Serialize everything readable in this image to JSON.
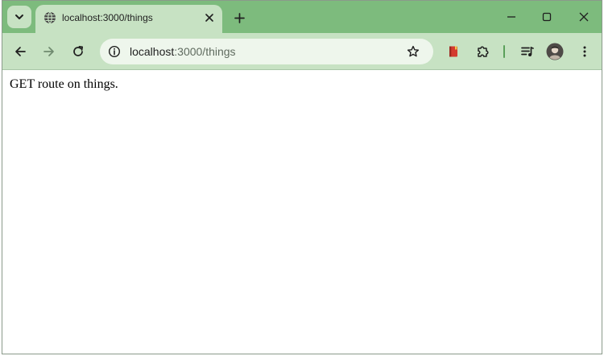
{
  "browser": {
    "tab": {
      "title": "localhost:3000/things",
      "favicon": "globe-icon"
    },
    "address_bar": {
      "host": "localhost",
      "path": ":3000/things"
    },
    "icons": {
      "tab_search": "chevron-down-icon",
      "close_tab": "close-icon",
      "new_tab": "plus-icon",
      "minimize": "minimize-icon",
      "maximize": "maximize-icon",
      "close_window": "close-icon",
      "back": "back-arrow-icon",
      "forward": "forward-arrow-icon",
      "reload": "reload-icon",
      "site_info": "info-icon",
      "bookmark": "star-icon",
      "extension_book": "book-icon",
      "extensions": "puzzle-icon",
      "media": "playlist-icon",
      "profile": "avatar",
      "menu": "more-vertical-icon"
    },
    "colors": {
      "frame": "#7dbb7d",
      "toolbar": "#c7e2c3",
      "omnibox": "#eef6ec",
      "accent": "#5aa05a"
    }
  },
  "page": {
    "body_text": "GET route on things."
  }
}
